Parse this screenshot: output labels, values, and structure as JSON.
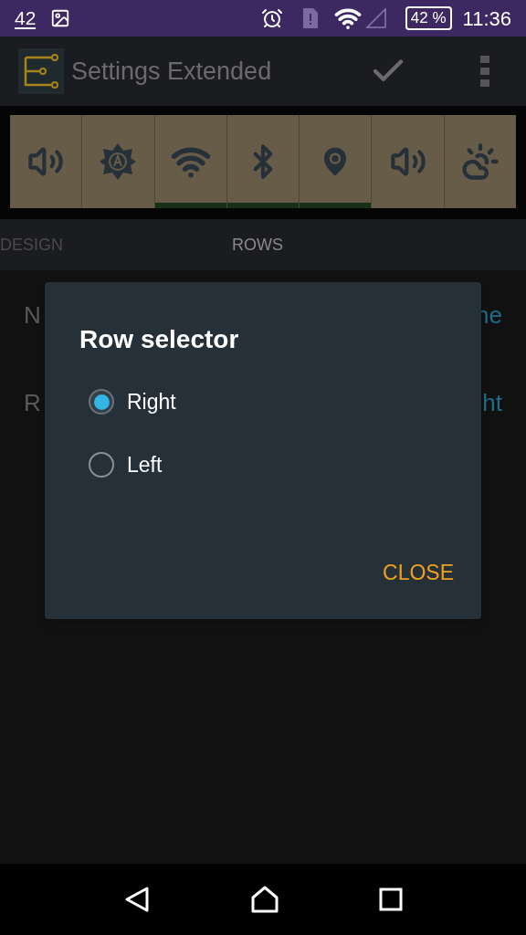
{
  "status_bar": {
    "notification_count": "42",
    "battery": "42 %",
    "time": "11:36"
  },
  "app_bar": {
    "title": "Settings Extended"
  },
  "tiles": [
    {
      "kind": "sound",
      "on": false
    },
    {
      "kind": "brightness",
      "on": false
    },
    {
      "kind": "wifi",
      "on": true
    },
    {
      "kind": "bluetooth",
      "on": true
    },
    {
      "kind": "location",
      "on": true
    },
    {
      "kind": "sound",
      "on": false
    },
    {
      "kind": "weather",
      "on": false
    }
  ],
  "tabs": [
    {
      "label": "DESIGN",
      "selected": false
    },
    {
      "label": "ROWS",
      "selected": true
    }
  ],
  "rows": [
    {
      "label": "N",
      "value": "ne"
    },
    {
      "label": "R",
      "value": "ht"
    }
  ],
  "dialog": {
    "title": "Row selector",
    "options": [
      {
        "label": "Right",
        "selected": true
      },
      {
        "label": "Left",
        "selected": false
      }
    ],
    "button": "CLOSE"
  }
}
